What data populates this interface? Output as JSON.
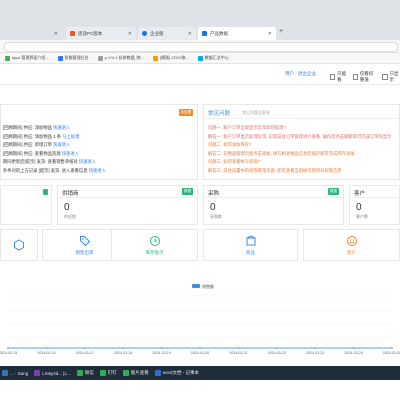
{
  "browser": {
    "tabs": [
      {
        "label": "思途PC版本"
      },
      {
        "label": "企业版"
      },
      {
        "label": "产品数据"
      }
    ],
    "new_tab": "+",
    "bookmarks": [
      {
        "label": "layui 管理界面介绍..."
      },
      {
        "label": "智能管理后台"
      },
      {
        "label": "p.Y/4.1 抗体数据_物..."
      },
      {
        "label": "[模版] CDO/移..."
      },
      {
        "label": "数据汇总中心"
      }
    ]
  },
  "header": {
    "links": [
      "用户",
      "退出企业"
    ],
    "checkboxes": [
      "只能看",
      "仅看权重值",
      "只显示"
    ]
  },
  "left_panel": {
    "badge": "未处理",
    "lines": [
      {
        "text": "[回顾期间] 供应: 添加物品",
        "link": "快速进入"
      },
      {
        "text": "[回顾期间] 供应: 添加物品 1 条",
        "link": "马上处理"
      },
      {
        "text": "[回顾期间] 供应: 新增订单",
        "link": "快速进入"
      },
      {
        "text": "[回顾期间] 供应: 查看物品资源",
        "link": "快速进入"
      },
      {
        "text": "期间更新后[提示] 发货: 查看销售单核对",
        "link": "快速进入"
      },
      {
        "text": "外件对的上方记录 [提示] 发货: 进入查看信息",
        "link": "快速进入"
      }
    ]
  },
  "right_panel": {
    "title": "常见问题",
    "subtitle": "常见问题及解答",
    "qa": [
      {
        "tag": "问题一:",
        "text": "账户订单出现显示异常如何处理?",
        "color": "#e06b6b"
      },
      {
        "tag": "解答一:",
        "text": "账户订单显示处理异常, 实现前往订单管理进行查看. 操作后点击刷新即可完成订单的显示",
        "color": "#e06b6b"
      },
      {
        "tag": "问题二:",
        "text": "如何添加库存?",
        "color": "#e07b3a"
      },
      {
        "tag": "解答二:",
        "text": "在物品管理页面点击添加, 填写相关物品信息后保存即可完成库存添加",
        "color": "#e07b3a"
      },
      {
        "tag": "问题三:",
        "text": "如何查看帐号权限?",
        "color": "#e07b3a"
      },
      {
        "tag": "解答三:",
        "text": "前往设置中的权限管理页面, 即可查看当前帐号的所有权限信息",
        "color": "#e07b3a"
      }
    ]
  },
  "kpis": [
    {
      "title": "",
      "badge": "",
      "value": "",
      "sub": ""
    },
    {
      "title": "供销商",
      "badge": "数据",
      "badge_color": "#2cb67d",
      "value": "0",
      "sub": "供应数"
    },
    {
      "title": "采购",
      "badge": "数据",
      "badge_color": "#2cb67d",
      "value": "0",
      "sub": "采购数"
    },
    {
      "title": "客户",
      "badge": "",
      "badge_color": "#2cb67d",
      "value": "0",
      "sub": "客户数"
    }
  ],
  "quick_links": [
    {
      "label": "",
      "icon": "cube-icon",
      "color": "#3a8ee6"
    },
    {
      "label": "销售出库",
      "icon": "tag-icon",
      "color": "#3a8ee6"
    },
    {
      "label": "库存盘点",
      "icon": "clock-icon",
      "color": "#2cb67d"
    },
    {
      "label": "商品",
      "icon": "box-icon",
      "color": "#3a8ee6"
    },
    {
      "label": "客户",
      "icon": "smile-icon",
      "color": "#f08c2e"
    }
  ],
  "chart_data": {
    "type": "line",
    "legend": [
      "销售额"
    ],
    "x": [
      "2024-03-15",
      "2024-03-16",
      "2024-03-17",
      "2024-03-18",
      "2024-03-19",
      "2024-03-20",
      "2024-03-21",
      "2024-03-22",
      "2024-03-23",
      "2024-03-24",
      "2024-03-25"
    ],
    "series": [
      {
        "name": "销售额",
        "values": [
          0,
          0,
          0,
          0,
          0,
          0,
          0,
          0,
          0,
          0,
          0
        ]
      }
    ],
    "grid": true
  },
  "taskbar": {
    "items": [
      "... - Sang",
      "Lm6y4d... [L...",
      "微信",
      "钉钉",
      "图片查看",
      "word文档 - 记事本"
    ]
  }
}
